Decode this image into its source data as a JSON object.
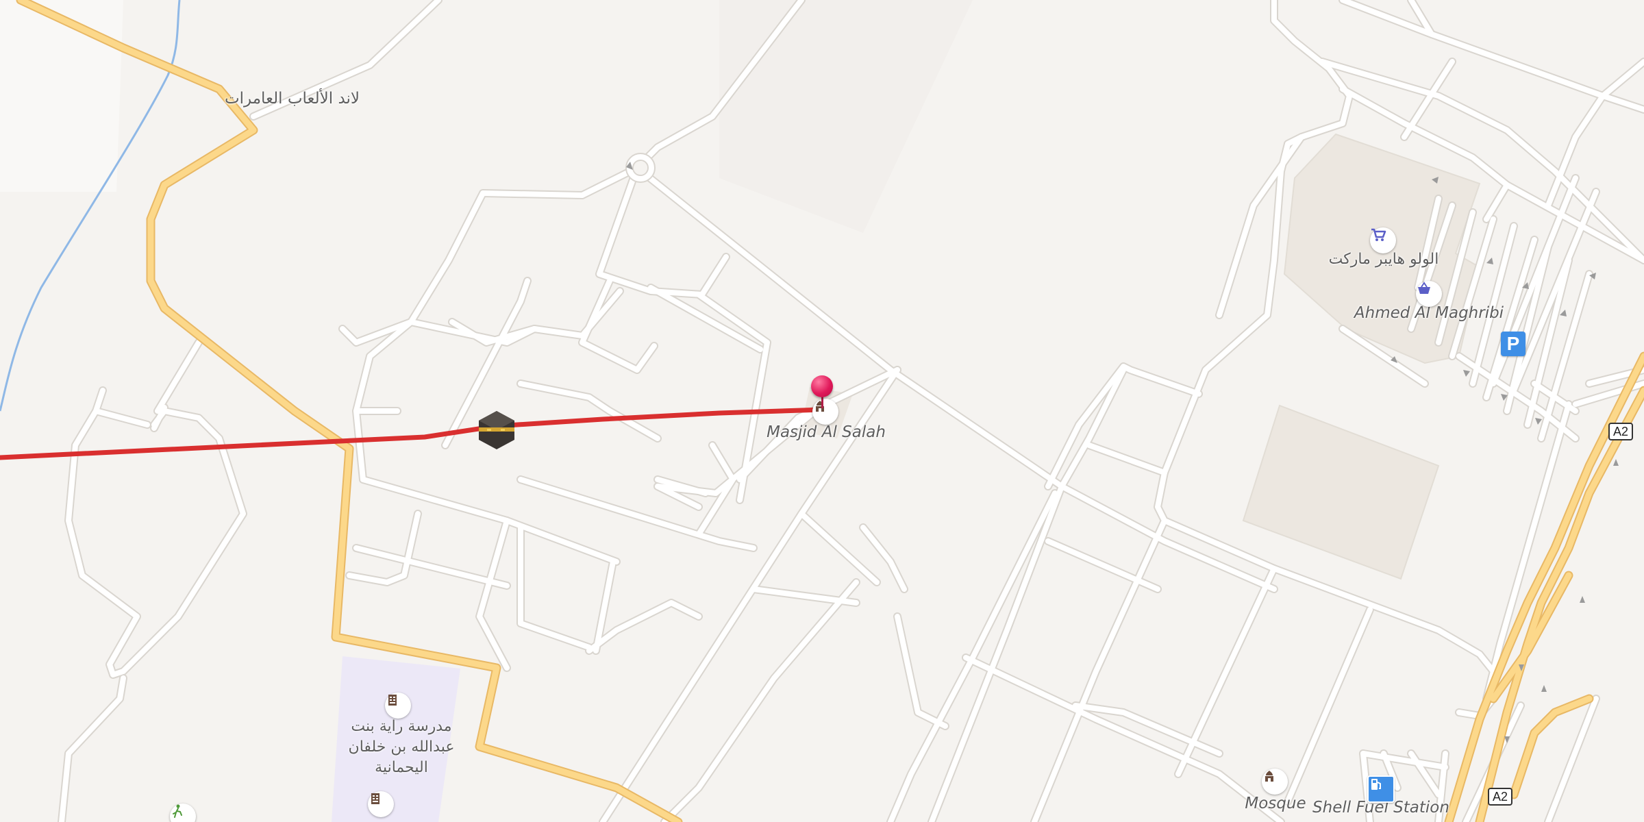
{
  "map": {
    "labels": {
      "top_left_place": "لاند الألعاب العامرات",
      "mosque_main": "Masjid Al Salah",
      "supermarket": "الولو هايبر ماركت",
      "shop": "Ahmed Al Maghribi",
      "mosque_bottom": "Mosque",
      "fuel": "Shell Fuel Station",
      "school_line1": "مدرسة راية بنت",
      "school_line2": "عبدالله بن خلفان",
      "school_line3": "اليحمانية"
    },
    "highway_shields": [
      "A2",
      "A2"
    ],
    "parking_label": "P",
    "icons": [
      "kaaba-icon",
      "mosque-icon",
      "cart-icon",
      "basket-icon",
      "parking-icon",
      "fuel-icon",
      "school-icon",
      "park-icon",
      "location-pin-icon"
    ],
    "colors": {
      "background": "#f5f3f0",
      "road": "#ffffff",
      "road_casing": "#d9d5cf",
      "major_road": "#fcd88a",
      "major_road_casing": "#e8b865",
      "route_line": "#d92f2f",
      "water": "#8fb8e6",
      "school_area": "#ece8f7",
      "building": "#ece7e0",
      "pin": "#e0195a",
      "parking": "#3f8fe6"
    }
  }
}
